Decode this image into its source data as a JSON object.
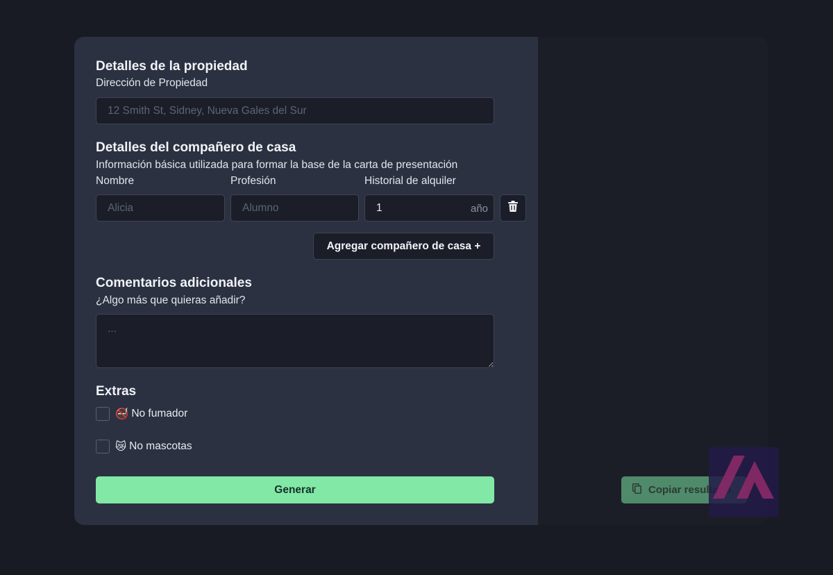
{
  "property": {
    "heading": "Detalles de la propiedad",
    "address_label": "Dirección de Propiedad",
    "address_placeholder": "12 Smith St, Sidney, Nueva Gales del Sur"
  },
  "housemate": {
    "heading": "Detalles del compañero de casa",
    "description": "Información básica utilizada para formar la base de la carta de presentación",
    "name_label": "Nombre",
    "profession_label": "Profesión",
    "history_label": "Historial de alquiler",
    "name_placeholder": "Alicia",
    "profession_placeholder": "Alumno",
    "history_value": "1",
    "history_suffix": "año",
    "add_button": "Agregar compañero de casa +"
  },
  "comments": {
    "heading": "Comentarios adicionales",
    "description": "¿Algo más que quieras añadir?",
    "placeholder": "..."
  },
  "extras": {
    "heading": "Extras",
    "options": [
      {
        "emoji": "🚭",
        "label": "No fumador",
        "checked": false
      },
      {
        "emoji": "😿",
        "label": "No mascotas",
        "checked": false
      }
    ]
  },
  "actions": {
    "generate": "Generar",
    "copy": "Copiar resultado"
  },
  "colors": {
    "page_bg": "#181b23",
    "form_bg": "#2b3141",
    "result_bg": "#1b1e27",
    "accent_green": "#82e8a6"
  }
}
